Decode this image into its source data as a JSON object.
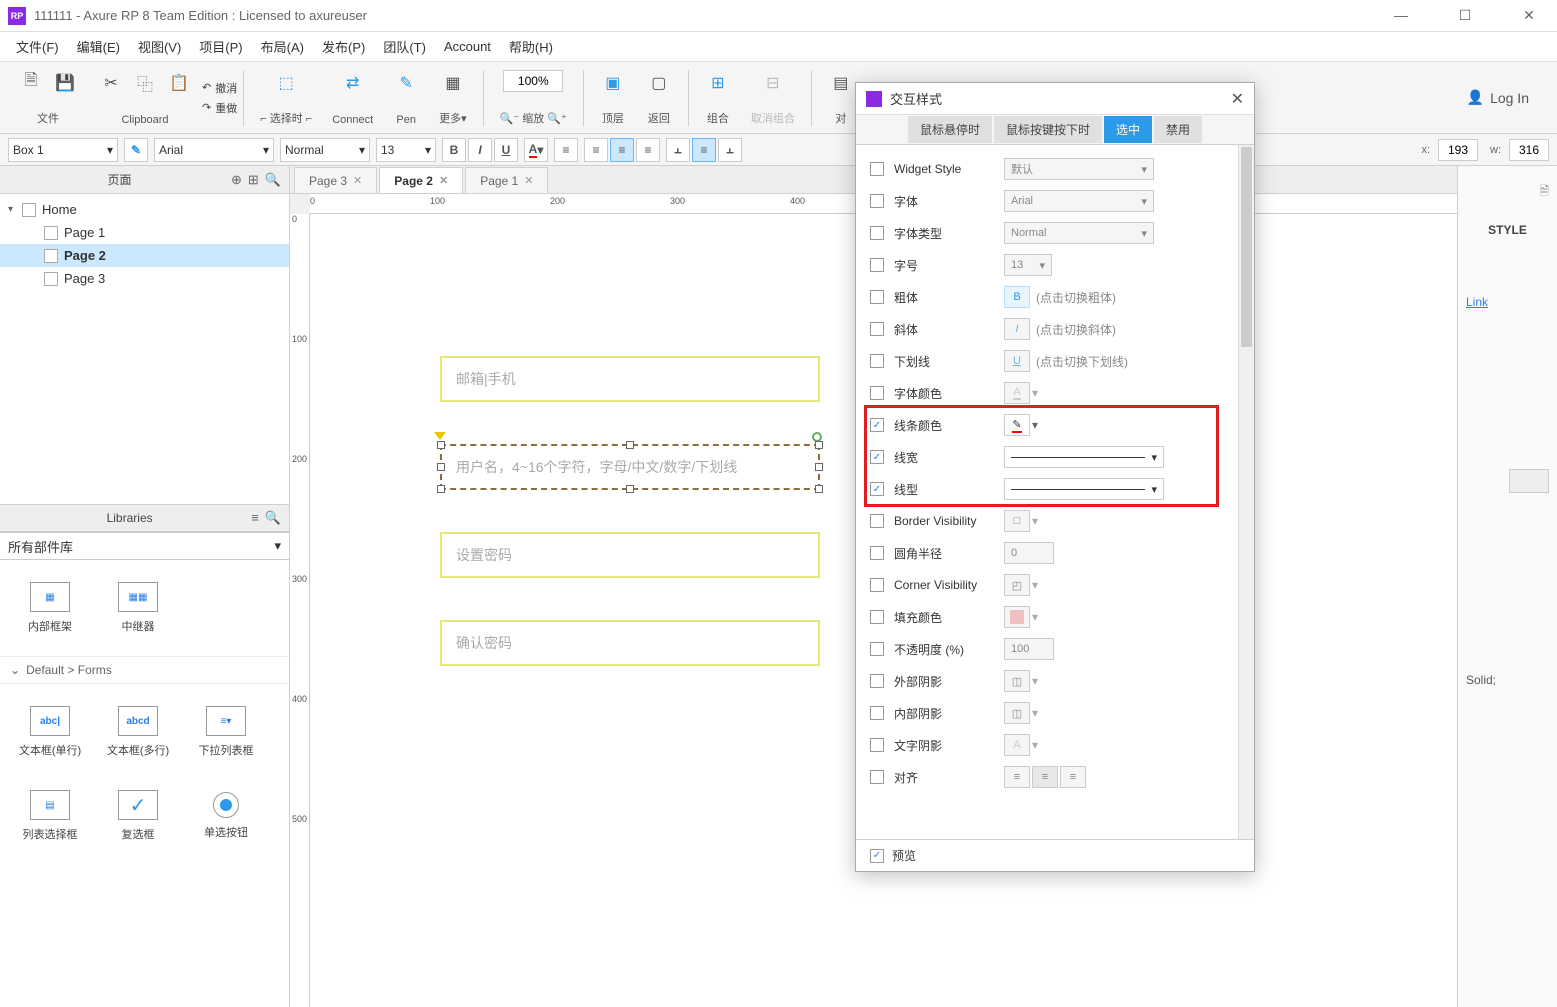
{
  "titlebar": {
    "title": "111111 - Axure RP 8 Team Edition : Licensed to axureuser"
  },
  "menubar": [
    "文件(F)",
    "编辑(E)",
    "视图(V)",
    "项目(P)",
    "布局(A)",
    "发布(P)",
    "团队(T)",
    "Account",
    "帮助(H)"
  ],
  "toolbar": {
    "file": "文件",
    "clipboard": "Clipboard",
    "undo": "撤消",
    "redo": "重做",
    "select": "选择时",
    "connect": "Connect",
    "pen": "Pen",
    "more": "更多▾",
    "zoom": "缩放",
    "zoom_value": "100%",
    "top": "顶层",
    "back": "返回",
    "group": "组合",
    "ungroup": "取消组合",
    "align": "对",
    "login": "Log In"
  },
  "formatbar": {
    "shape": "Box 1",
    "font": "Arial",
    "weight": "Normal",
    "size": "13",
    "x": "193",
    "w": "316"
  },
  "left": {
    "pages_title": "页面",
    "home": "Home",
    "pages": [
      "Page 1",
      "Page 2",
      "Page 3"
    ],
    "lib_title": "Libraries",
    "lib_select": "所有部件库",
    "lib_items_top": [
      "内部框架",
      "中继器"
    ],
    "lib_cat": "Default > Forms",
    "lib_items": [
      "文本框(单行)",
      "文本框(多行)",
      "下拉列表框",
      "列表选择框",
      "复选框",
      "单选按钮"
    ]
  },
  "tabs": [
    "Page 3",
    "Page 2",
    "Page 1"
  ],
  "canvas": {
    "field1": "邮箱|手机",
    "field2": "用户名，4~16个字符，字母/中文/数字/下划线",
    "field3": "设置密码",
    "field4": "确认密码"
  },
  "right": {
    "style": "STYLE",
    "link": "Link",
    "solid": "Solid;"
  },
  "dialog": {
    "title": "交互样式",
    "tabs": [
      "鼠标悬停时",
      "鼠标按键按下时",
      "选中",
      "禁用"
    ],
    "preview": "预览",
    "props": {
      "widget_style": {
        "label": "Widget Style",
        "value": "默认"
      },
      "font": {
        "label": "字体",
        "value": "Arial"
      },
      "font_type": {
        "label": "字体类型",
        "value": "Normal"
      },
      "font_size": {
        "label": "字号",
        "value": "13"
      },
      "bold": {
        "label": "粗体",
        "hint": "(点击切换粗体)"
      },
      "italic": {
        "label": "斜体",
        "hint": "(点击切换斜体)"
      },
      "underline": {
        "label": "下划线",
        "hint": "(点击切换下划线)"
      },
      "font_color": {
        "label": "字体颜色"
      },
      "line_color": {
        "label": "线条颜色"
      },
      "line_width": {
        "label": "线宽"
      },
      "line_style": {
        "label": "线型"
      },
      "border_vis": {
        "label": "Border Visibility"
      },
      "radius": {
        "label": "圆角半径",
        "value": "0"
      },
      "corner_vis": {
        "label": "Corner Visibility"
      },
      "fill": {
        "label": "填充颜色"
      },
      "opacity": {
        "label": "不透明度 (%)",
        "value": "100"
      },
      "outer_shadow": {
        "label": "外部阴影"
      },
      "inner_shadow": {
        "label": "内部阴影"
      },
      "text_shadow": {
        "label": "文字阴影"
      },
      "align": {
        "label": "对齐"
      }
    }
  }
}
